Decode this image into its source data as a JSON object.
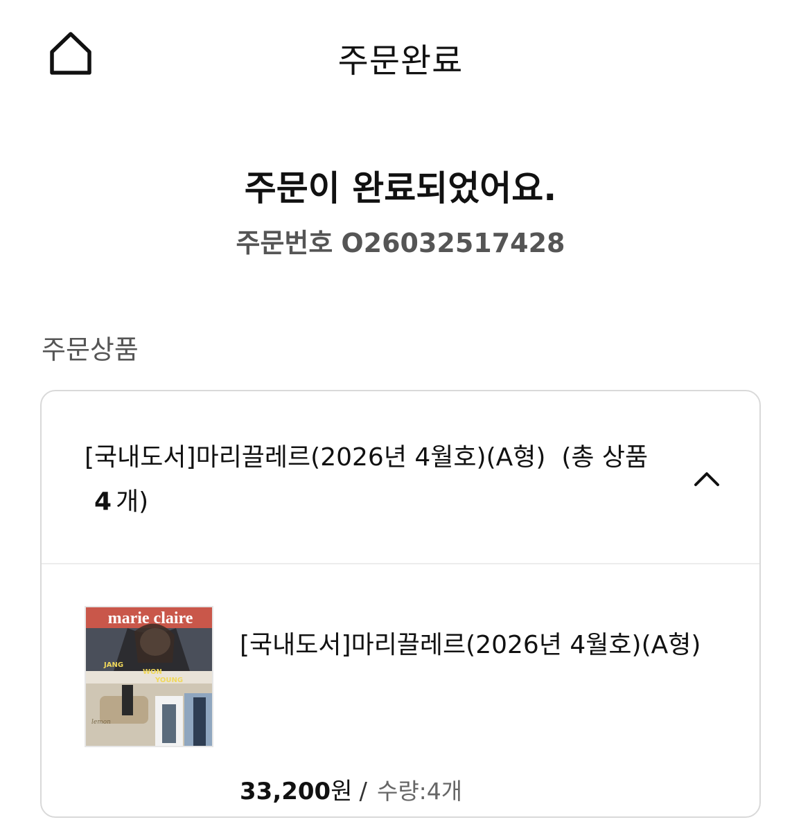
{
  "header": {
    "title": "주문완료",
    "home_icon": "home-icon"
  },
  "confirmation": {
    "message": "주문이 완료되었어요.",
    "order_number_label": "주문번호",
    "order_number": "O26032517428"
  },
  "section": {
    "label": "주문상품"
  },
  "order_summary": {
    "title": "[국내도서]마리끌레르(2026년 4월호)(A형)",
    "count_prefix": "(총 상품",
    "count": "4",
    "count_suffix": "개)",
    "toggle_icon": "chevron-up-icon"
  },
  "item": {
    "cover_title": "marie claire",
    "cover_text_1": "JANG",
    "cover_text_2": "WON",
    "cover_text_3": "YOUNG",
    "name": "[국내도서]마리끌레르(2026년 4월호)(A형)",
    "price": "33,200",
    "currency": "원",
    "separator": "/",
    "quantity": "수량:4개"
  },
  "colors": {
    "text_primary": "#111111",
    "text_secondary": "#555555",
    "card_border": "#d9d9d9"
  }
}
